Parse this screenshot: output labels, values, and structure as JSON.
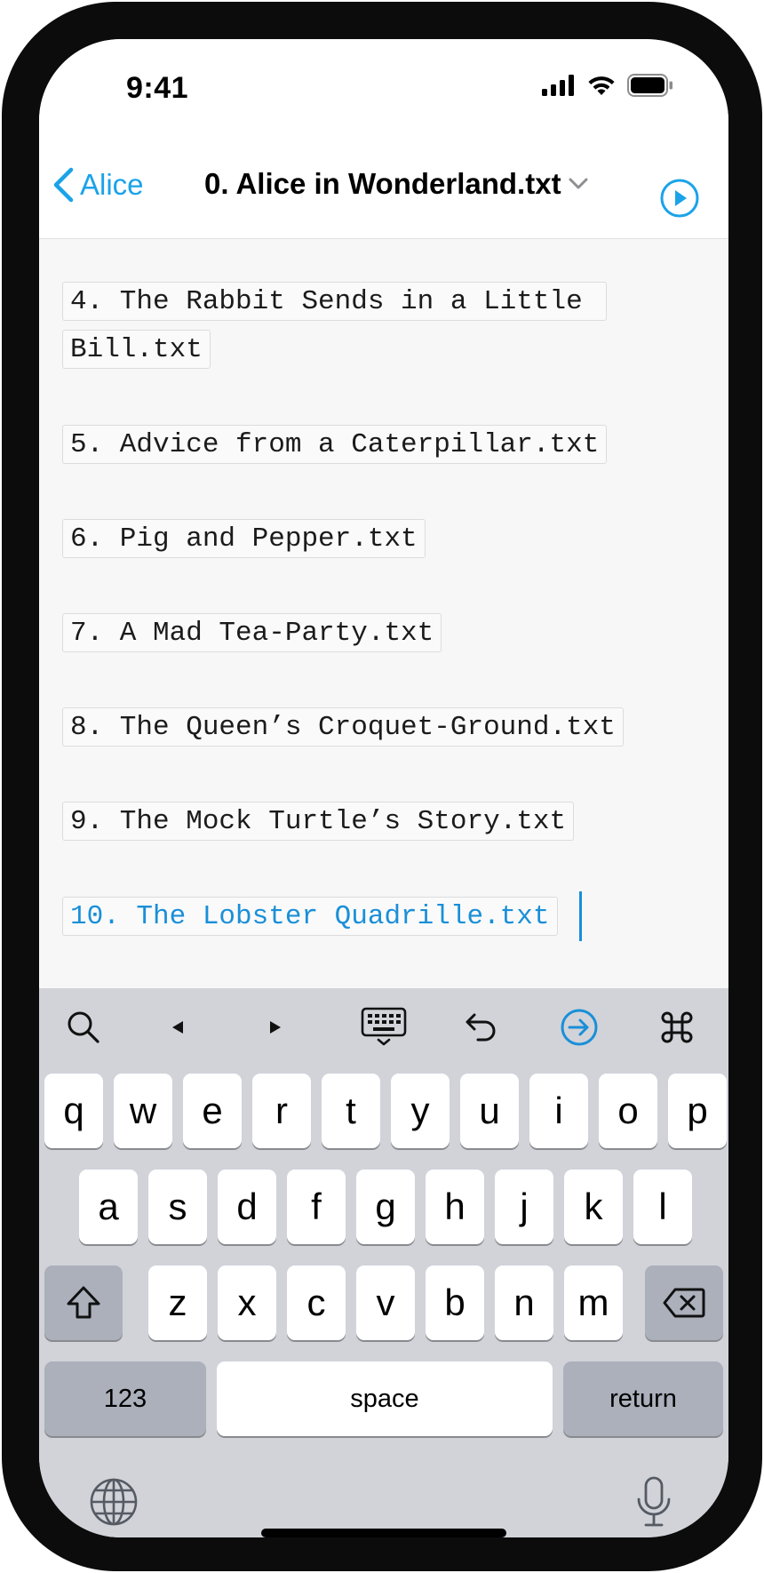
{
  "status_bar": {
    "time": "9:41",
    "icons": [
      "cellular-signal-icon",
      "wifi-icon",
      "battery-icon"
    ]
  },
  "nav": {
    "back_label": "Alice",
    "title": "0. Alice in Wonderland.txt",
    "title_icon": "chevron-down-icon",
    "action_icon": "play-circle-icon",
    "accent_color": "#1aa3e8"
  },
  "editor": {
    "files": [
      {
        "line1": "4. The Rabbit Sends in a Little ",
        "line2": "Bill.txt"
      },
      {
        "line1": "5. Advice from a Caterpillar.txt"
      },
      {
        "line1": "6. Pig and Pepper.txt"
      },
      {
        "line1": "7. A Mad Tea-Party.txt"
      },
      {
        "line1": "8. The Queen’s Croquet-Ground.txt"
      },
      {
        "line1": "9. The Mock Turtle’s Story.txt"
      },
      {
        "line1": "10. The Lobster Quadrille.txt"
      }
    ],
    "active_color": "#1a8fd8"
  },
  "keyboard": {
    "toolbar": [
      "search-icon",
      "arrow-left-icon",
      "arrow-right-icon",
      "keyboard-dismiss-icon",
      "undo-icon",
      "tab-forward-icon",
      "command-icon"
    ],
    "row1": [
      "q",
      "w",
      "e",
      "r",
      "t",
      "y",
      "u",
      "i",
      "o",
      "p"
    ],
    "row2": [
      "a",
      "s",
      "d",
      "f",
      "g",
      "h",
      "j",
      "k",
      "l"
    ],
    "row3": [
      "z",
      "x",
      "c",
      "v",
      "b",
      "n",
      "m"
    ],
    "numbers_label": "123",
    "space_label": "space",
    "return_label": "return"
  }
}
